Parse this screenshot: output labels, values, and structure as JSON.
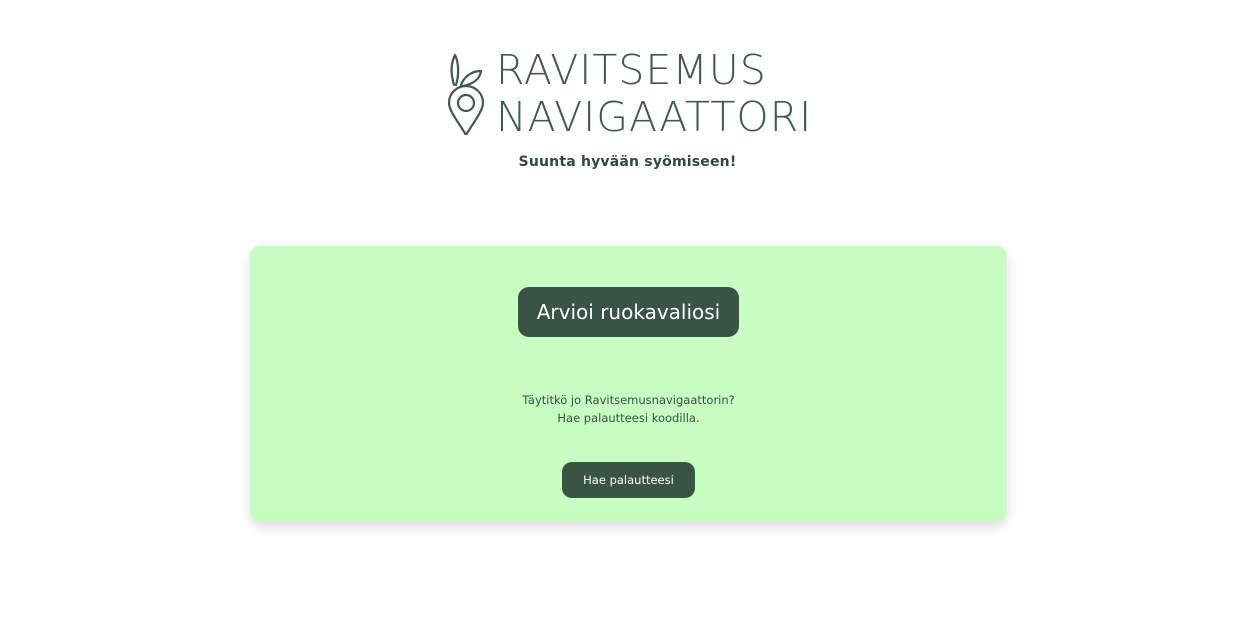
{
  "header": {
    "logo_line_1": "RAVITSEMUS",
    "logo_line_2": "NAVIGAATTORI",
    "logo_icon": "carrot-location-pin-icon",
    "tagline": "Suunta hyvään syömiseen!"
  },
  "card": {
    "primary_button_label": "Arvioi ruokavaliosi",
    "prompt_line_1": "Täytitkö jo Ravitsemusnavigaattorin?",
    "prompt_line_2": "Hae palautteesi koodilla.",
    "secondary_button_label": "Hae palautteesi"
  },
  "colors": {
    "brand_dark": "#395445",
    "card_background": "#c7fdc0",
    "logo_text": "#3c5b4b"
  }
}
